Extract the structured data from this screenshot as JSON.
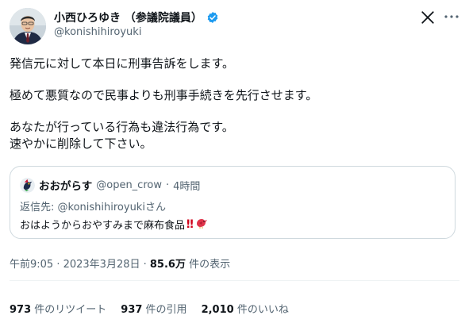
{
  "author": {
    "display_name": "小西ひろゆき （参議院議員）",
    "handle": "@konishihiroyuki",
    "verified_icon": "verified-badge-icon"
  },
  "tweet": {
    "lines": [
      "発信元に対して本日に刑事告訴をします。",
      "極めて悪質なので民事よりも刑事手続きを先行させます。",
      "あなたが行っている行為も違法行為です。",
      "速やかに削除して下さい。"
    ]
  },
  "quoted": {
    "display_name": "おおがらす",
    "handle": "@open_crow",
    "separator": "·",
    "time": "4時間",
    "reply_prefix": "返信先: ",
    "reply_to": "@konishihiroyuki",
    "reply_suffix": "さん",
    "text": "おはようからおやすみまで麻布食品",
    "emojis": [
      "double-exclamation-icon",
      "bird-icon"
    ],
    "emoji_bang": "‼"
  },
  "meta": {
    "time_date": "午前9:05 · 2023年3月28日 · ",
    "views_count": "85.6万",
    "views_label": " 件の表示"
  },
  "stats": {
    "retweets_count": "973",
    "retweets_label": " 件のリツイート",
    "quotes_count": "937",
    "quotes_label": " 件の引用",
    "likes_count": "2,010",
    "likes_label": " 件のいいね"
  },
  "colors": {
    "verified": "#1d9bf0",
    "muted": "#536471",
    "border": "#cfd9de",
    "text": "#0f1419"
  }
}
